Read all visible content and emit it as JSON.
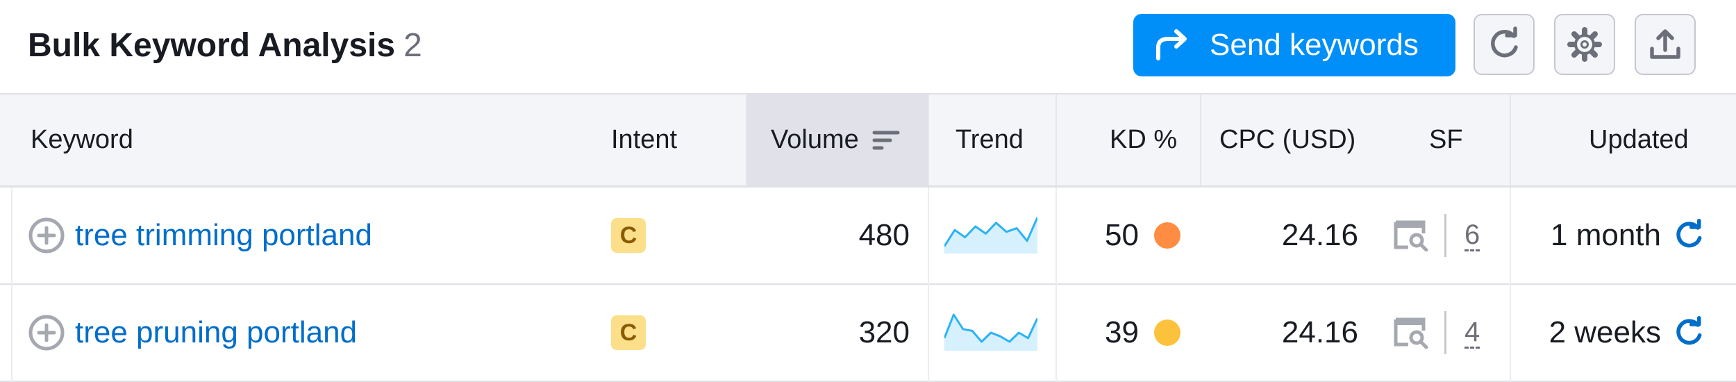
{
  "header": {
    "title": "Bulk Keyword Analysis",
    "count": "2",
    "send_label": "Send keywords"
  },
  "columns": {
    "keyword": "Keyword",
    "intent": "Intent",
    "volume": "Volume",
    "trend": "Trend",
    "kd": "KD %",
    "cpc": "CPC (USD)",
    "sf": "SF",
    "updated": "Updated"
  },
  "rows": [
    {
      "keyword": "tree trimming portland",
      "intent": "C",
      "volume": "480",
      "trend": [
        0.2,
        0.65,
        0.45,
        0.75,
        0.55,
        0.85,
        0.6,
        0.7,
        0.35,
        1.0
      ],
      "kd": "50",
      "kd_color": "#ff8c43",
      "cpc": "24.16",
      "sf": "6",
      "updated": "1 month"
    },
    {
      "keyword": "tree pruning portland",
      "intent": "C",
      "volume": "320",
      "trend": [
        0.35,
        1.0,
        0.6,
        0.55,
        0.25,
        0.5,
        0.4,
        0.25,
        0.5,
        0.35,
        0.9
      ],
      "kd": "39",
      "kd_color": "#fdc23c",
      "cpc": "24.16",
      "sf": "4",
      "updated": "2 weeks"
    }
  ],
  "colors": {
    "accent": "#008ff8",
    "link": "#006dca",
    "trend_line": "#2bb3f3",
    "trend_fill": "#d6f0fd",
    "intent_bg": "#fcdf8b"
  }
}
